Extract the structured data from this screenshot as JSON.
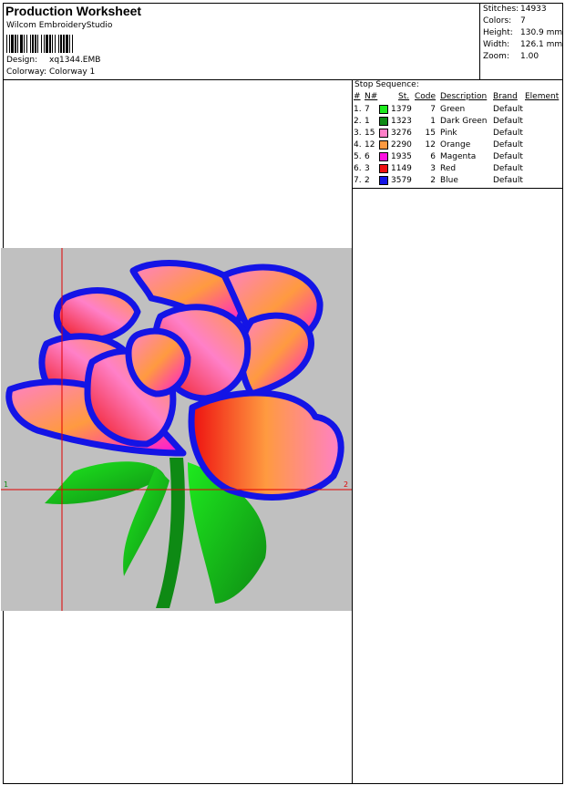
{
  "header": {
    "title": "Production Worksheet",
    "software": "Wilcom EmbroideryStudio",
    "design_label": "Design:",
    "design_value": "xq1344.EMB",
    "colorway_label": "Colorway:",
    "colorway_value": "Colorway 1"
  },
  "stats": {
    "stitches_label": "Stitches:",
    "stitches": "14933",
    "colors_label": "Colors:",
    "colors": "7",
    "height_label": "Height:",
    "height": "130.9 mm",
    "width_label": "Width:",
    "width": "126.1 mm",
    "zoom_label": "Zoom:",
    "zoom": "1.00"
  },
  "stop_sequence": {
    "title": "Stop Sequence:",
    "headers": {
      "num": "#",
      "n": "N#",
      "st": "St.",
      "code": "Code",
      "description": "Description",
      "brand": "Brand",
      "element": "Element"
    },
    "rows": [
      {
        "num": "1.",
        "n": "7",
        "color": "#1eea1e",
        "st": "1379",
        "code": "7",
        "description": "Green",
        "brand": "Default"
      },
      {
        "num": "2.",
        "n": "1",
        "color": "#0e8a14",
        "st": "1323",
        "code": "1",
        "description": "Dark Green",
        "brand": "Default"
      },
      {
        "num": "3.",
        "n": "15",
        "color": "#ff80c8",
        "st": "3276",
        "code": "15",
        "description": "Pink",
        "brand": "Default"
      },
      {
        "num": "4.",
        "n": "12",
        "color": "#ff9a40",
        "st": "2290",
        "code": "12",
        "description": "Orange",
        "brand": "Default"
      },
      {
        "num": "5.",
        "n": "6",
        "color": "#ff10e0",
        "st": "1935",
        "code": "6",
        "description": "Magenta",
        "brand": "Default"
      },
      {
        "num": "6.",
        "n": "3",
        "color": "#ee1010",
        "st": "1149",
        "code": "3",
        "description": "Red",
        "brand": "Default"
      },
      {
        "num": "7.",
        "n": "2",
        "color": "#1414e6",
        "st": "3579",
        "code": "2",
        "description": "Blue",
        "brand": "Default"
      }
    ]
  },
  "preview": {
    "marker_start": "1",
    "marker_end": "2",
    "background_color": "#c0c0c0",
    "guide_color": "#e00000"
  }
}
